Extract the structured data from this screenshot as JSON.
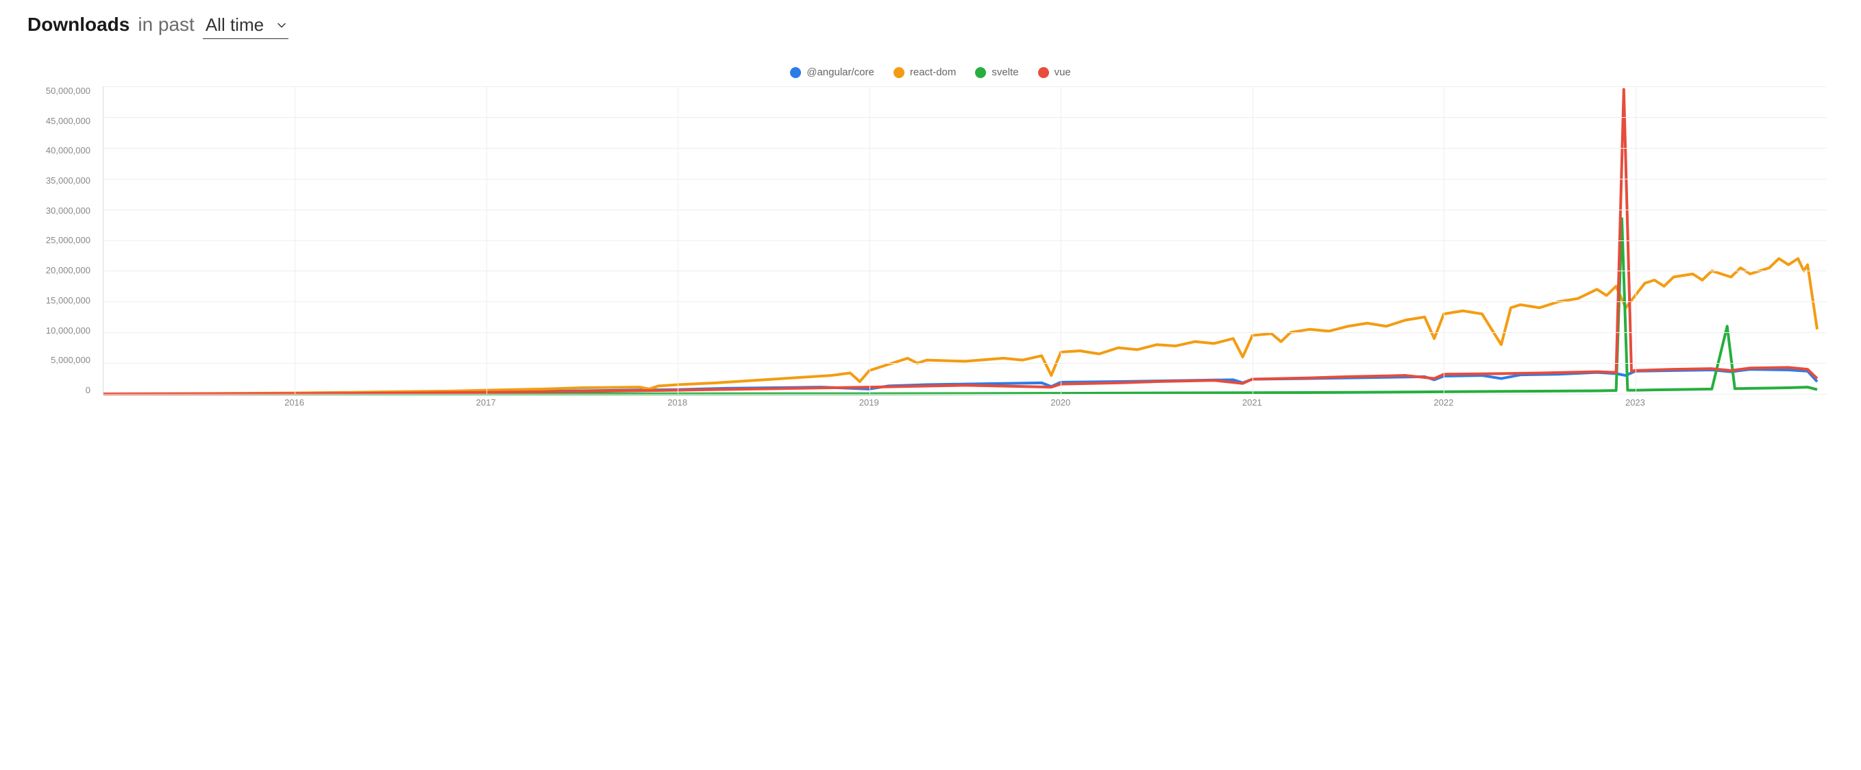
{
  "header": {
    "title": "Downloads",
    "sub": "in past",
    "dropdown_value": "All time"
  },
  "legend": [
    {
      "name": "@angular/core",
      "color": "#2b7ce9"
    },
    {
      "name": "react-dom",
      "color": "#f39c12"
    },
    {
      "name": "svelte",
      "color": "#27ae3f"
    },
    {
      "name": "vue",
      "color": "#e74c3c"
    }
  ],
  "colors": {
    "angular": "#2b7ce9",
    "react": "#f39c12",
    "svelte": "#27ae3f",
    "vue": "#e74c3c"
  },
  "chart_data": {
    "type": "line",
    "title": "",
    "xlabel": "",
    "ylabel": "",
    "x_range": [
      2015.0,
      2024.0
    ],
    "ylim": [
      0,
      50000000
    ],
    "y_ticks": [
      "50,000,000",
      "45,000,000",
      "40,000,000",
      "35,000,000",
      "30,000,000",
      "25,000,000",
      "20,000,000",
      "15,000,000",
      "10,000,000",
      "5,000,000",
      "0"
    ],
    "x_ticks": [
      2016,
      2017,
      2018,
      2019,
      2020,
      2021,
      2022,
      2023
    ],
    "series": [
      {
        "name": "@angular/core",
        "color": "#2b7ce9",
        "points": [
          [
            2015.0,
            0
          ],
          [
            2015.5,
            0
          ],
          [
            2016.0,
            50000
          ],
          [
            2016.5,
            150000
          ],
          [
            2017.0,
            300000
          ],
          [
            2017.5,
            500000
          ],
          [
            2018.0,
            700000
          ],
          [
            2018.25,
            900000
          ],
          [
            2018.5,
            1000000
          ],
          [
            2018.75,
            1100000
          ],
          [
            2019.0,
            800000
          ],
          [
            2019.1,
            1300000
          ],
          [
            2019.3,
            1500000
          ],
          [
            2019.5,
            1600000
          ],
          [
            2019.7,
            1700000
          ],
          [
            2019.9,
            1800000
          ],
          [
            2019.95,
            1200000
          ],
          [
            2020.0,
            1900000
          ],
          [
            2020.3,
            2000000
          ],
          [
            2020.5,
            2100000
          ],
          [
            2020.7,
            2200000
          ],
          [
            2020.9,
            2300000
          ],
          [
            2020.95,
            1800000
          ],
          [
            2021.0,
            2400000
          ],
          [
            2021.3,
            2500000
          ],
          [
            2021.5,
            2600000
          ],
          [
            2021.7,
            2700000
          ],
          [
            2021.9,
            2800000
          ],
          [
            2021.95,
            2300000
          ],
          [
            2022.0,
            2900000
          ],
          [
            2022.2,
            3000000
          ],
          [
            2022.3,
            2500000
          ],
          [
            2022.4,
            3100000
          ],
          [
            2022.6,
            3200000
          ],
          [
            2022.8,
            3500000
          ],
          [
            2022.9,
            3300000
          ],
          [
            2022.95,
            3000000
          ],
          [
            2023.0,
            3700000
          ],
          [
            2023.2,
            3800000
          ],
          [
            2023.4,
            3900000
          ],
          [
            2023.5,
            3600000
          ],
          [
            2023.6,
            4000000
          ],
          [
            2023.8,
            3900000
          ],
          [
            2023.9,
            3700000
          ],
          [
            2023.95,
            2000000
          ]
        ]
      },
      {
        "name": "react-dom",
        "color": "#f39c12",
        "points": [
          [
            2015.0,
            0
          ],
          [
            2015.5,
            50000
          ],
          [
            2016.0,
            150000
          ],
          [
            2016.3,
            250000
          ],
          [
            2016.5,
            350000
          ],
          [
            2016.8,
            450000
          ],
          [
            2017.0,
            600000
          ],
          [
            2017.3,
            800000
          ],
          [
            2017.5,
            1000000
          ],
          [
            2017.8,
            1100000
          ],
          [
            2017.85,
            800000
          ],
          [
            2017.9,
            1300000
          ],
          [
            2018.0,
            1500000
          ],
          [
            2018.2,
            1800000
          ],
          [
            2018.4,
            2200000
          ],
          [
            2018.6,
            2600000
          ],
          [
            2018.8,
            3000000
          ],
          [
            2018.9,
            3400000
          ],
          [
            2018.95,
            2000000
          ],
          [
            2019.0,
            3800000
          ],
          [
            2019.1,
            4800000
          ],
          [
            2019.2,
            5800000
          ],
          [
            2019.25,
            5000000
          ],
          [
            2019.3,
            5500000
          ],
          [
            2019.5,
            5300000
          ],
          [
            2019.7,
            5800000
          ],
          [
            2019.8,
            5500000
          ],
          [
            2019.9,
            6200000
          ],
          [
            2019.95,
            3000000
          ],
          [
            2020.0,
            6800000
          ],
          [
            2020.1,
            7000000
          ],
          [
            2020.2,
            6500000
          ],
          [
            2020.3,
            7500000
          ],
          [
            2020.4,
            7200000
          ],
          [
            2020.5,
            8000000
          ],
          [
            2020.6,
            7800000
          ],
          [
            2020.7,
            8500000
          ],
          [
            2020.8,
            8200000
          ],
          [
            2020.9,
            9000000
          ],
          [
            2020.95,
            6000000
          ],
          [
            2021.0,
            9500000
          ],
          [
            2021.1,
            9800000
          ],
          [
            2021.15,
            8500000
          ],
          [
            2021.2,
            10000000
          ],
          [
            2021.3,
            10500000
          ],
          [
            2021.4,
            10200000
          ],
          [
            2021.5,
            11000000
          ],
          [
            2021.6,
            11500000
          ],
          [
            2021.7,
            11000000
          ],
          [
            2021.8,
            12000000
          ],
          [
            2021.9,
            12500000
          ],
          [
            2021.95,
            9000000
          ],
          [
            2022.0,
            13000000
          ],
          [
            2022.1,
            13500000
          ],
          [
            2022.2,
            13000000
          ],
          [
            2022.3,
            8000000
          ],
          [
            2022.35,
            14000000
          ],
          [
            2022.4,
            14500000
          ],
          [
            2022.5,
            14000000
          ],
          [
            2022.6,
            15000000
          ],
          [
            2022.7,
            15500000
          ],
          [
            2022.8,
            17000000
          ],
          [
            2022.85,
            16000000
          ],
          [
            2022.9,
            17500000
          ],
          [
            2022.95,
            14000000
          ],
          [
            2023.0,
            16000000
          ],
          [
            2023.05,
            18000000
          ],
          [
            2023.1,
            18500000
          ],
          [
            2023.15,
            17500000
          ],
          [
            2023.2,
            19000000
          ],
          [
            2023.3,
            19500000
          ],
          [
            2023.35,
            18500000
          ],
          [
            2023.4,
            20000000
          ],
          [
            2023.5,
            19000000
          ],
          [
            2023.55,
            20500000
          ],
          [
            2023.6,
            19500000
          ],
          [
            2023.65,
            20000000
          ],
          [
            2023.7,
            20500000
          ],
          [
            2023.75,
            22000000
          ],
          [
            2023.8,
            21000000
          ],
          [
            2023.85,
            22000000
          ],
          [
            2023.88,
            20000000
          ],
          [
            2023.9,
            21000000
          ],
          [
            2023.95,
            10500000
          ]
        ]
      },
      {
        "name": "svelte",
        "color": "#27ae3f",
        "points": [
          [
            2015.0,
            0
          ],
          [
            2017.0,
            0
          ],
          [
            2018.0,
            10000
          ],
          [
            2019.0,
            30000
          ],
          [
            2019.5,
            60000
          ],
          [
            2020.0,
            100000
          ],
          [
            2020.5,
            150000
          ],
          [
            2021.0,
            200000
          ],
          [
            2021.5,
            250000
          ],
          [
            2022.0,
            350000
          ],
          [
            2022.5,
            450000
          ],
          [
            2022.8,
            500000
          ],
          [
            2022.9,
            550000
          ],
          [
            2022.93,
            28500000
          ],
          [
            2022.96,
            600000
          ],
          [
            2023.0,
            600000
          ],
          [
            2023.2,
            700000
          ],
          [
            2023.4,
            800000
          ],
          [
            2023.48,
            11000000
          ],
          [
            2023.52,
            850000
          ],
          [
            2023.6,
            900000
          ],
          [
            2023.7,
            950000
          ],
          [
            2023.8,
            1000000
          ],
          [
            2023.9,
            1100000
          ],
          [
            2023.95,
            700000
          ]
        ]
      },
      {
        "name": "vue",
        "color": "#e74c3c",
        "points": [
          [
            2015.0,
            0
          ],
          [
            2016.0,
            50000
          ],
          [
            2016.5,
            120000
          ],
          [
            2017.0,
            250000
          ],
          [
            2017.5,
            400000
          ],
          [
            2018.0,
            600000
          ],
          [
            2018.5,
            850000
          ],
          [
            2019.0,
            1100000
          ],
          [
            2019.5,
            1400000
          ],
          [
            2019.95,
            1100000
          ],
          [
            2020.0,
            1600000
          ],
          [
            2020.3,
            1800000
          ],
          [
            2020.5,
            2000000
          ],
          [
            2020.8,
            2200000
          ],
          [
            2020.95,
            1700000
          ],
          [
            2021.0,
            2400000
          ],
          [
            2021.3,
            2600000
          ],
          [
            2021.5,
            2800000
          ],
          [
            2021.8,
            3000000
          ],
          [
            2021.95,
            2500000
          ],
          [
            2022.0,
            3200000
          ],
          [
            2022.3,
            3300000
          ],
          [
            2022.5,
            3400000
          ],
          [
            2022.8,
            3600000
          ],
          [
            2022.9,
            3500000
          ],
          [
            2022.94,
            49500000
          ],
          [
            2022.98,
            3700000
          ],
          [
            2023.0,
            3800000
          ],
          [
            2023.2,
            4000000
          ],
          [
            2023.4,
            4100000
          ],
          [
            2023.5,
            3800000
          ],
          [
            2023.6,
            4200000
          ],
          [
            2023.8,
            4300000
          ],
          [
            2023.9,
            4000000
          ],
          [
            2023.95,
            2500000
          ]
        ]
      }
    ]
  }
}
